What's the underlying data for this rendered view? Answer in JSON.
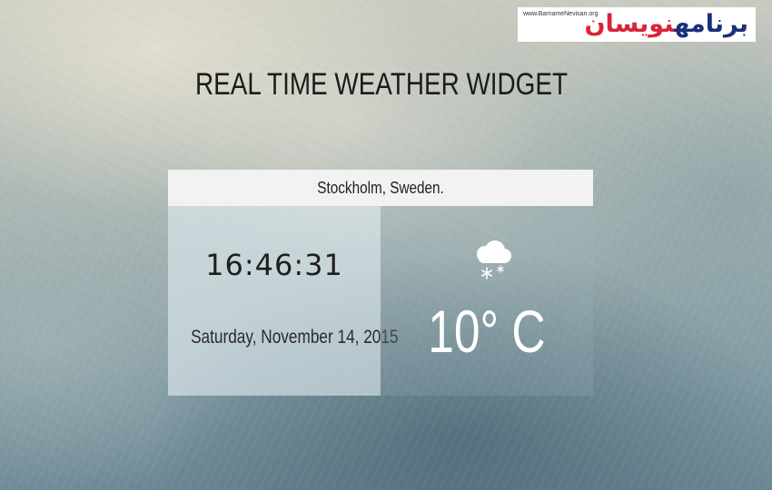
{
  "header": {
    "title": "REAL TIME WEATHER WIDGET"
  },
  "logo": {
    "site_url": "www.BarnameNevisan.org",
    "mark_part_a": "برنامه",
    "mark_part_b": "نویسان"
  },
  "widget": {
    "location": "Stockholm, Sweden.",
    "time": "16:46:31",
    "date": "Saturday, November 14, 2015",
    "temperature": "10° C",
    "condition_icon": "cloud-snow-icon"
  },
  "colors": {
    "location_bar_bg": "#f2f2f2",
    "text_dark": "#1b1b1b",
    "temperature_text": "#ffffff",
    "logo_blue": "#1c2f7a",
    "logo_red": "#d8243a"
  }
}
